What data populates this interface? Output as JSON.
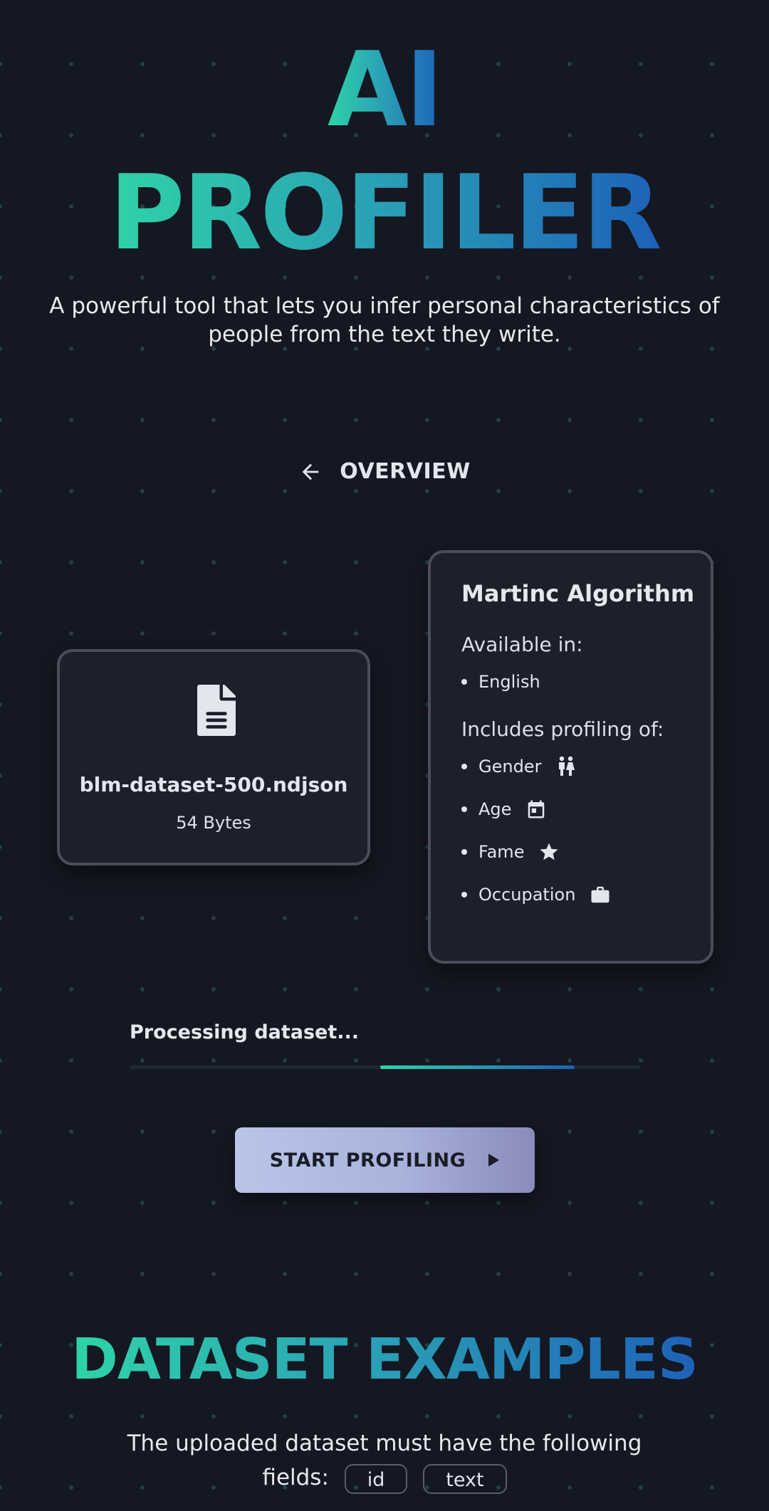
{
  "hero": {
    "title_line1": "AI",
    "title_line2": "PROFILER",
    "subtitle": "A powerful tool that lets you infer personal characteristics of people from the text they write."
  },
  "nav": {
    "back_label": "OVERVIEW",
    "back_icon": "arrow-left-icon"
  },
  "file": {
    "icon": "document-icon",
    "name": "blm-dataset-500.ndjson",
    "size": "54 Bytes"
  },
  "algorithm": {
    "title": "Martinc Algorithm",
    "available_label": "Available in:",
    "languages": [
      "English"
    ],
    "profiling_label": "Includes profiling of:",
    "traits": [
      {
        "label": "Gender",
        "icon": "gender-icon"
      },
      {
        "label": "Age",
        "icon": "calendar-icon"
      },
      {
        "label": "Fame",
        "icon": "star-icon"
      },
      {
        "label": "Occupation",
        "icon": "briefcase-icon"
      }
    ]
  },
  "progress": {
    "label": "Processing dataset...",
    "indeterminate": true
  },
  "actions": {
    "start_label": "START PROFILING",
    "start_icon": "play-icon"
  },
  "examples": {
    "title": "DATASET EXAMPLES",
    "desc": "The uploaded dataset must have the following fields:",
    "fields": [
      "id",
      "text"
    ]
  },
  "colors": {
    "background": "#141822",
    "card": "#1d1f2b",
    "gradient_start": "#2fd3a7",
    "gradient_end": "#1d61b8",
    "button_start": "#b8c5e8",
    "button_end": "#8a8bbb"
  }
}
